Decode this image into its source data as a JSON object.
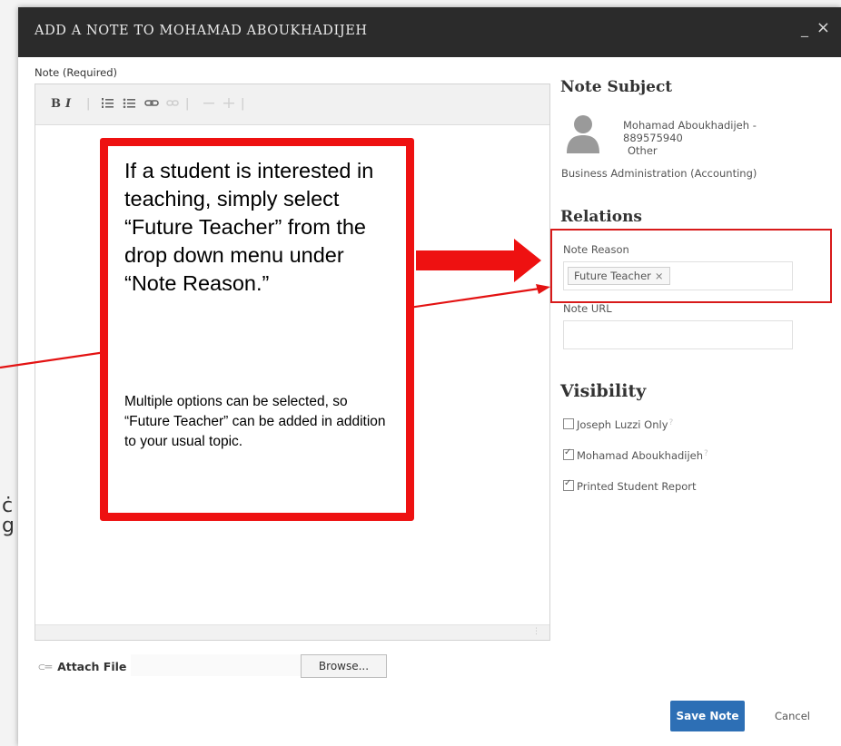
{
  "dialog": {
    "title": "ADD A NOTE TO MOHAMAD ABOUKHADIJEH",
    "minimize": "_",
    "close": "×"
  },
  "note": {
    "label": "Note (Required)",
    "toolbar": {
      "bold": "B",
      "italic": "I",
      "icons": [
        "ordered-list-icon",
        "bullet-list-icon",
        "link-icon",
        "unlink-icon",
        "outdent-icon",
        "indent-icon"
      ]
    }
  },
  "attach": {
    "label": "Attach File",
    "browse_label": "Browse..."
  },
  "subject": {
    "heading": "Note Subject",
    "name": "Mohamad Aboukhadijeh -",
    "id": "889575940",
    "role": "Other",
    "program": "Business Administration (Accounting)"
  },
  "relations": {
    "heading": "Relations",
    "reason_label": "Note Reason",
    "reason_tag": "Future Teacher",
    "reason_tag_remove": "×",
    "url_label": "Note URL",
    "url_value": ""
  },
  "visibility": {
    "heading": "Visibility",
    "options": [
      {
        "label": "Joseph Luzzi Only",
        "checked": false,
        "help": "?"
      },
      {
        "label": "Mohamad Aboukhadijeh",
        "checked": true,
        "help": "?"
      },
      {
        "label": "Printed Student Report",
        "checked": true,
        "help": ""
      }
    ]
  },
  "actions": {
    "save": "Save Note",
    "cancel": "Cancel"
  },
  "callout": {
    "main": "If a student is interested in teaching, simply select “Future Teacher” from the drop down menu under “Note Reason.”",
    "sub": "Multiple options can be selected, so “Future Teacher” can be added in addition to your usual topic."
  },
  "colors": {
    "titlebar": "#2b2b2b",
    "annotation_red": "#ee1111",
    "primary_button": "#2d6fb5"
  }
}
